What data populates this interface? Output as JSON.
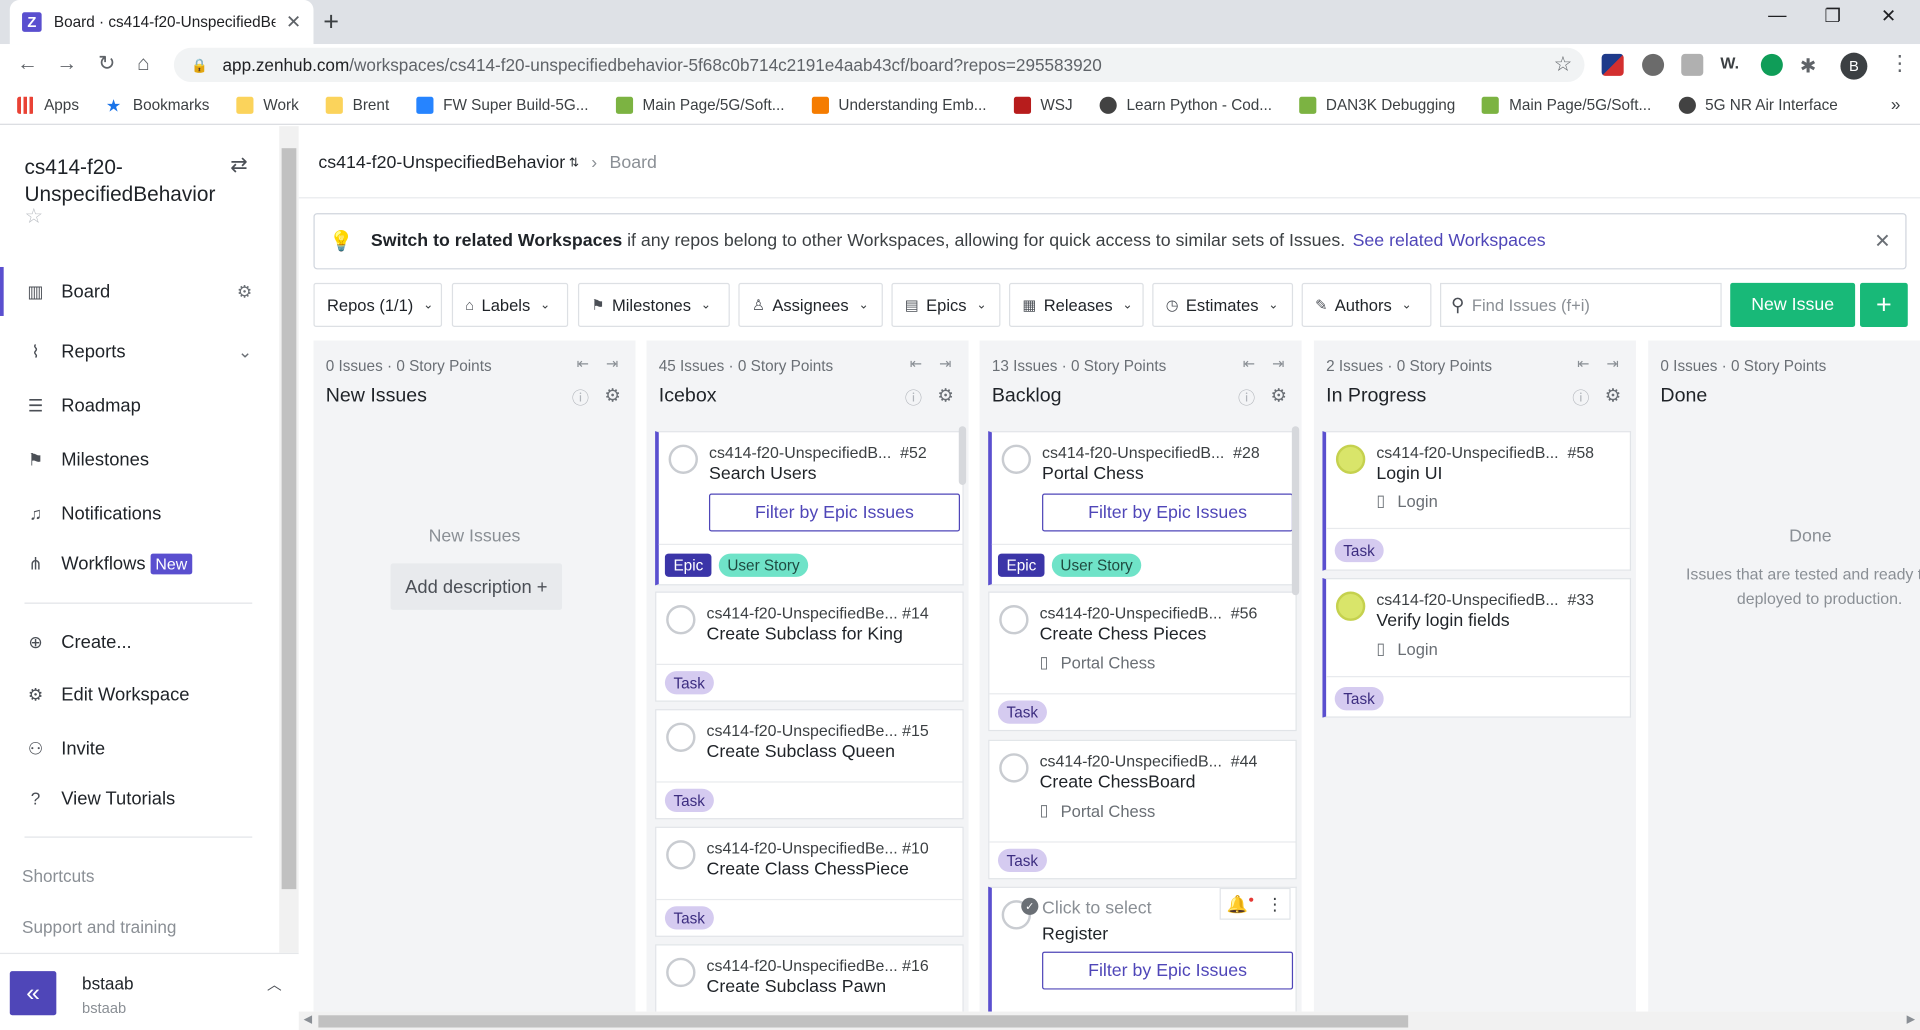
{
  "browser": {
    "tab_title": "Board · cs414-f20-UnspecifiedBe",
    "tab_favicon": "Z",
    "url_host": "app.zenhub.com",
    "url_path": "/workspaces/cs414-f20-unspecifiedbehavior-5f68c0b714c2191e4aab43cf/board?repos=295583920",
    "profile_initial": "B",
    "bookmarks": [
      {
        "label": "Apps",
        "icon_color": "#e94235"
      },
      {
        "label": "Bookmarks",
        "icon_color": "#1a73e8"
      },
      {
        "label": "Work",
        "icon_color": "#fbd35b"
      },
      {
        "label": "Brent",
        "icon_color": "#fbd35b"
      },
      {
        "label": "FW Super Build-5G...",
        "icon_color": "#2684ff"
      },
      {
        "label": "Main Page/5G/Soft...",
        "icon_color": "#7cb342"
      },
      {
        "label": "Understanding Emb...",
        "icon_color": "#f57c00"
      },
      {
        "label": "WSJ",
        "icon_color": "#b71c1c"
      },
      {
        "label": "Learn Python - Cod...",
        "icon_color": "#424242"
      },
      {
        "label": "DAN3K Debugging",
        "icon_color": "#7cb342"
      },
      {
        "label": "Main Page/5G/Soft...",
        "icon_color": "#7cb342"
      },
      {
        "label": "5G NR Air Interface",
        "icon_color": "#424242"
      }
    ],
    "bookmarks_more": "»"
  },
  "sidebar": {
    "workspace_name": "cs414-f20-UnspecifiedBehavior",
    "nav": [
      {
        "label": "Board",
        "icon": "board-icon",
        "glyph": "▥"
      },
      {
        "label": "Reports",
        "icon": "reports-icon",
        "glyph": "⌇"
      },
      {
        "label": "Roadmap",
        "icon": "roadmap-icon",
        "glyph": "☰"
      },
      {
        "label": "Milestones",
        "icon": "milestone-icon",
        "glyph": "⚑"
      },
      {
        "label": "Notifications",
        "icon": "bell-icon",
        "glyph": "🔔"
      },
      {
        "label": "Workflows",
        "icon": "workflow-icon",
        "glyph": "⋔"
      }
    ],
    "workflows_badge": "New",
    "actions": [
      {
        "label": "Create...",
        "icon": "plus-circle-icon",
        "glyph": "⊕"
      },
      {
        "label": "Edit Workspace",
        "icon": "gear-icon",
        "glyph": "⚙"
      },
      {
        "label": "Invite",
        "icon": "invite-icon",
        "glyph": "⚇"
      },
      {
        "label": "View Tutorials",
        "icon": "help-icon",
        "glyph": "?"
      }
    ],
    "shortcuts_label": "Shortcuts",
    "support_label": "Support and training",
    "user": {
      "name": "bstaab",
      "handle": "bstaab"
    }
  },
  "main": {
    "breadcrumb_workspace": "cs414-f20-UnspecifiedBehavior",
    "breadcrumb_current": "Board",
    "banner": {
      "bold": "Switch to related Workspaces",
      "text": "if any repos belong to other Workspaces, allowing for quick access to similar sets of Issues.",
      "link": "See related Workspaces"
    },
    "filters": {
      "repos": "Repos (1/1)",
      "labels": "Labels",
      "milestones": "Milestones",
      "assignees": "Assignees",
      "epics": "Epics",
      "releases": "Releases",
      "estimates": "Estimates",
      "authors": "Authors",
      "search_placeholder": "Find Issues (f+i)",
      "new_issue": "New Issue"
    }
  },
  "pipelines": {
    "new_issues": {
      "meta": "0 Issues · 0 Story Points",
      "title": "New Issues",
      "empty": "New Issues",
      "add_desc": "Add description +"
    },
    "icebox": {
      "meta": "45 Issues · 0 Story Points",
      "title": "Icebox"
    },
    "backlog": {
      "meta": "13 Issues · 0 Story Points",
      "title": "Backlog"
    },
    "in_progress": {
      "meta": "2 Issues · 0 Story Points",
      "title": "In Progress"
    },
    "done": {
      "meta": "0 Issues · 0 Story Points",
      "title": "Done",
      "empty": "Done",
      "desc": "Issues that are tested and ready to be deployed to production."
    }
  },
  "cards": {
    "icebox": [
      {
        "repo": "cs414-f20-UnspecifiedB...",
        "num": "#52",
        "title": "Search Users",
        "filter_btn": "Filter by Epic Issues",
        "labels": [
          "Epic",
          "User Story"
        ]
      },
      {
        "repo": "cs414-f20-UnspecifiedBe...",
        "num": "#14",
        "title": "Create Subclass for King",
        "labels": [
          "Task"
        ]
      },
      {
        "repo": "cs414-f20-UnspecifiedBe...",
        "num": "#15",
        "title": "Create Subclass Queen",
        "labels": [
          "Task"
        ]
      },
      {
        "repo": "cs414-f20-UnspecifiedBe...",
        "num": "#10",
        "title": "Create Class ChessPiece",
        "labels": [
          "Task"
        ]
      },
      {
        "repo": "cs414-f20-UnspecifiedBe...",
        "num": "#16",
        "title": "Create Subclass Pawn",
        "labels": []
      }
    ],
    "backlog": [
      {
        "repo": "cs414-f20-UnspecifiedB...",
        "num": "#28",
        "title": "Portal Chess",
        "filter_btn": "Filter by Epic Issues",
        "labels": [
          "Epic",
          "User Story"
        ]
      },
      {
        "repo": "cs414-f20-UnspecifiedB...",
        "num": "#56",
        "title": "Create Chess Pieces",
        "epic": "Portal Chess",
        "labels": [
          "Task"
        ]
      },
      {
        "repo": "cs414-f20-UnspecifiedB...",
        "num": "#44",
        "title": "Create ChessBoard",
        "epic": "Portal Chess",
        "labels": [
          "Task"
        ]
      },
      {
        "select": "Click to select",
        "title": "Register",
        "filter_btn": "Filter by Epic Issues"
      }
    ],
    "in_progress": [
      {
        "repo": "cs414-f20-UnspecifiedB...",
        "num": "#58",
        "title": "Login UI",
        "epic": "Login",
        "labels": [
          "Task"
        ]
      },
      {
        "repo": "cs414-f20-UnspecifiedB...",
        "num": "#33",
        "title": "Verify login fields",
        "epic": "Login",
        "labels": [
          "Task"
        ]
      }
    ]
  },
  "colors": {
    "accent": "#5a4fcf",
    "green": "#18b978",
    "epic_label": "#3b35a8",
    "story_label": "#6fe3c8",
    "task_label": "#d5cbf0"
  }
}
